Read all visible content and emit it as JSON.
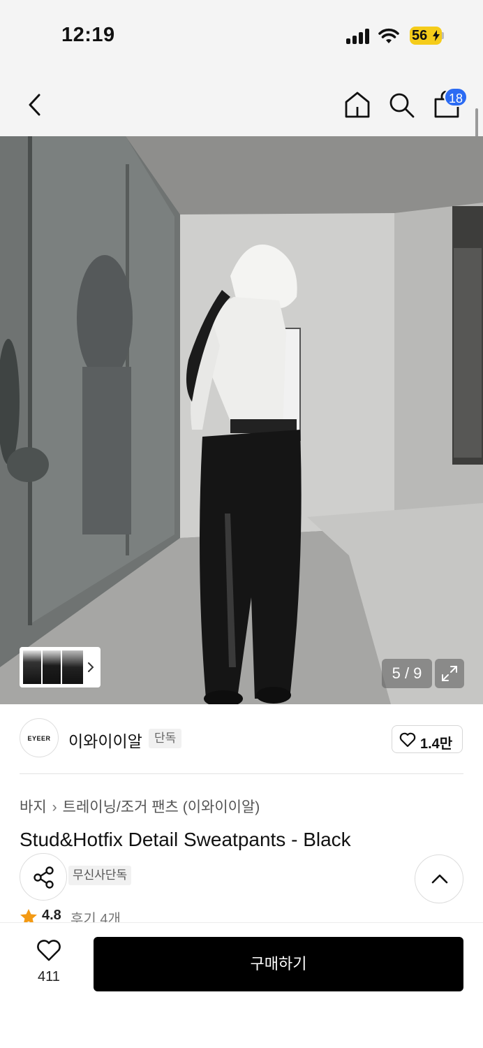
{
  "status_bar": {
    "time": "12:19",
    "battery": "56"
  },
  "nav": {
    "back_icon": "chevron-left-icon",
    "home_icon": "home-icon",
    "search_icon": "search-icon",
    "cart_icon": "shopping-bag-icon",
    "cart_count": "18"
  },
  "gallery": {
    "counter": "5 / 9",
    "current_index": 5,
    "total": 9,
    "expand_icon": "expand-icon"
  },
  "brand": {
    "logo_text": "EYEER",
    "name": "이와이이알",
    "tag": "단독",
    "like_count": "1.4만"
  },
  "breadcrumb": {
    "category": "바지",
    "subcategory": "트레이닝/조거 팬츠 (이와이이알)"
  },
  "product": {
    "title": "Stud&Hotfix Detail Sweatpants - Black",
    "exclusive_tag": "무신사단독",
    "rating": "4.8",
    "reviews": "후기 4개"
  },
  "bottom": {
    "wish_count": "411",
    "buy_label": "구매하기"
  },
  "colors": {
    "badge_blue": "#2b6bf3",
    "battery_yellow": "#f5cc1a",
    "star_orange": "#f39a14",
    "buy_button": "#000000"
  }
}
